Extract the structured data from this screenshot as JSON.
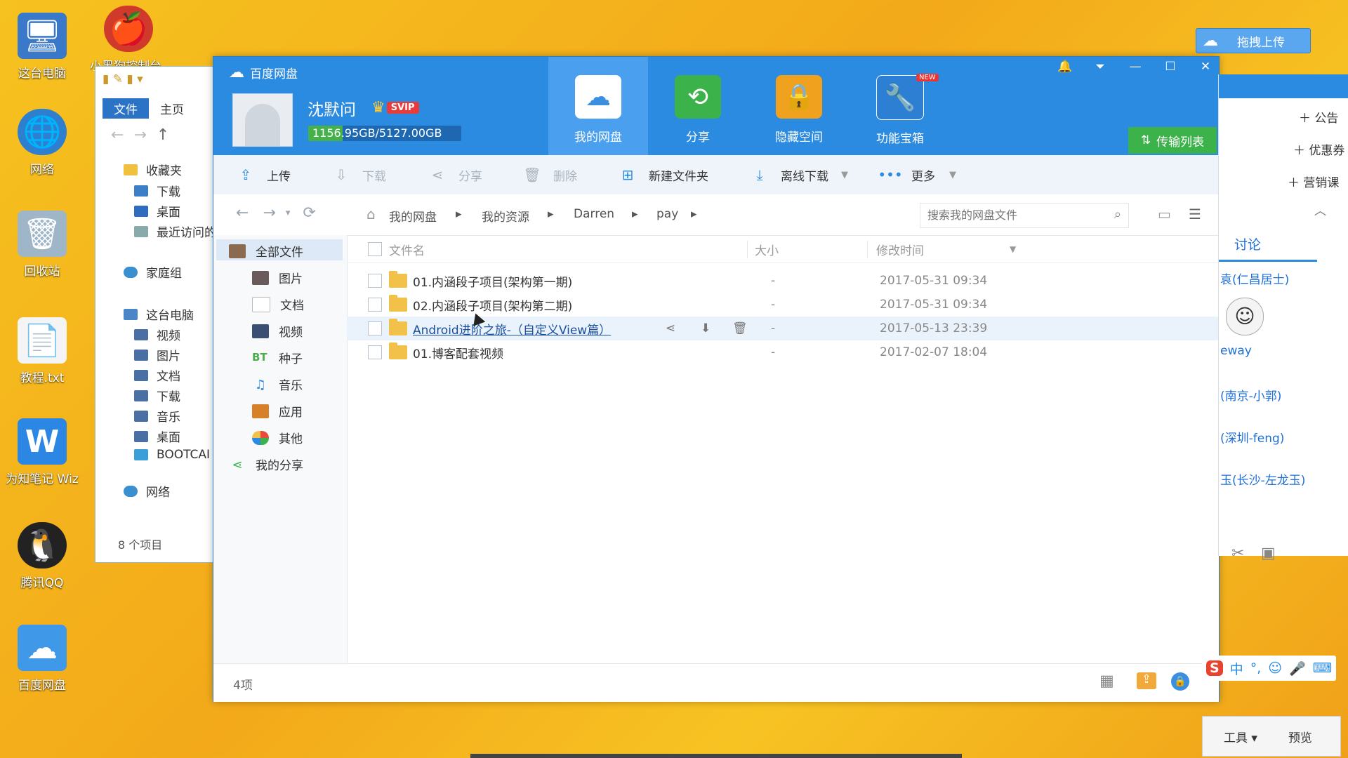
{
  "desktop": {
    "icons": [
      {
        "label": "这台电脑",
        "icon": "computer-icon"
      },
      {
        "label": "小黑狗控制台",
        "icon": "apple-shield-icon"
      },
      {
        "label": "网络",
        "icon": "network-globe-icon"
      },
      {
        "label": "回收站",
        "icon": "recycle-bin-icon"
      },
      {
        "label": "教程.txt",
        "icon": "text-file-icon"
      },
      {
        "label": "为知笔记 Wiz",
        "icon": "wiz-note-icon"
      },
      {
        "label": "腾讯QQ",
        "icon": "qq-penguin-icon"
      },
      {
        "label": "百度网盘",
        "icon": "baidu-cloud-icon"
      }
    ],
    "drag_upload_label": "拖拽上传"
  },
  "explorer": {
    "tabs": [
      "文件",
      "主页"
    ],
    "nav": [
      "收藏夹",
      "下载",
      "桌面",
      "最近访问的",
      "家庭组",
      "这台电脑",
      "视频",
      "图片",
      "文档",
      "下载",
      "音乐",
      "桌面",
      "BOOTCAI",
      "网络"
    ],
    "item_count": "8 个项目"
  },
  "app": {
    "title": "百度网盘",
    "username": "沈默问",
    "vip_badge": "SVIP",
    "storage": "1156.95GB/5127.00GB",
    "storage_fraction": 0.2257,
    "tabs": [
      {
        "label": "我的网盘",
        "icon": "cloud-disk-icon"
      },
      {
        "label": "分享",
        "icon": "share-icon"
      },
      {
        "label": "隐藏空间",
        "icon": "lock-icon"
      },
      {
        "label": "功能宝箱",
        "icon": "toolbox-icon"
      }
    ],
    "new_badge": "NEW",
    "transfer_label": "传输列表",
    "toolbar": {
      "upload": "上传",
      "download": "下载",
      "share": "分享",
      "delete": "删除",
      "new_folder": "新建文件夹",
      "offline_download": "离线下载",
      "more": "更多"
    },
    "breadcrumb": [
      "我的网盘",
      "我的资源",
      "Darren",
      "pay"
    ],
    "search_placeholder": "搜索我的网盘文件",
    "categories": [
      "全部文件",
      "图片",
      "文档",
      "视频",
      "种子",
      "音乐",
      "应用",
      "其他",
      "我的分享"
    ],
    "bt_label": "BT",
    "columns": {
      "name": "文件名",
      "size": "大小",
      "modified": "修改时间"
    },
    "files": [
      {
        "name": "01.内涵段子项目(架构第一期)",
        "size": "-",
        "modified": "2017-05-31 09:34"
      },
      {
        "name": "02.内涵段子项目(架构第二期)",
        "size": "-",
        "modified": "2017-05-31 09:34"
      },
      {
        "name": "Android进阶之旅-（自定义View篇）",
        "size": "-",
        "modified": "2017-05-13 23:39"
      },
      {
        "name": "01.博客配套视频",
        "size": "-",
        "modified": "2017-02-07 18:04"
      }
    ],
    "status_count": "4项"
  },
  "right_panel": {
    "items": [
      "公告",
      "优惠券",
      "营销课"
    ],
    "tab": "讨论",
    "users": [
      "袁(仁昌居士)",
      "eway",
      "(南京-小郭)",
      "(深圳-feng)",
      "玉(长沙-左龙玉)"
    ],
    "tools_label": "工具",
    "preview_label": "预览",
    "ime_label": "中"
  },
  "colors": {
    "accent": "#2b8be0",
    "desktop": "#f3b51e",
    "transfer_green": "#3cb34a",
    "vip_red": "#e83c3c"
  }
}
